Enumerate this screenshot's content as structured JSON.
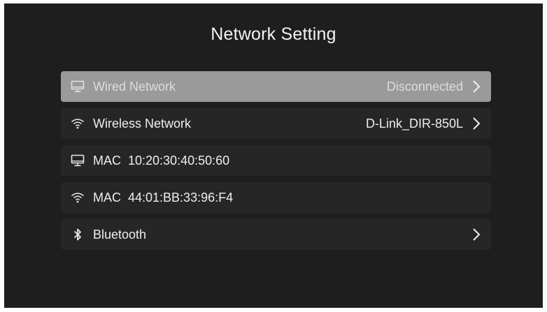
{
  "title": "Network Setting",
  "items": [
    {
      "icon": "monitor-icon",
      "label": "Wired Network",
      "value": "Disconnected",
      "has_chevron": true,
      "selected": true
    },
    {
      "icon": "wifi-icon",
      "label": "Wireless Network",
      "value": "D-Link_DIR-850L",
      "has_chevron": true,
      "selected": false
    },
    {
      "icon": "monitor-icon",
      "label": "MAC  10:20:30:40:50:60",
      "value": "",
      "has_chevron": false,
      "selected": false
    },
    {
      "icon": "wifi-icon",
      "label": "MAC  44:01:BB:33:96:F4",
      "value": "",
      "has_chevron": false,
      "selected": false
    },
    {
      "icon": "bluetooth-icon",
      "label": "Bluetooth",
      "value": "",
      "has_chevron": true,
      "selected": false
    }
  ],
  "colors": {
    "background": "#1e1e1e",
    "row": "#262626",
    "selected_row": "#9a9a9a",
    "text": "#eeeeee"
  }
}
